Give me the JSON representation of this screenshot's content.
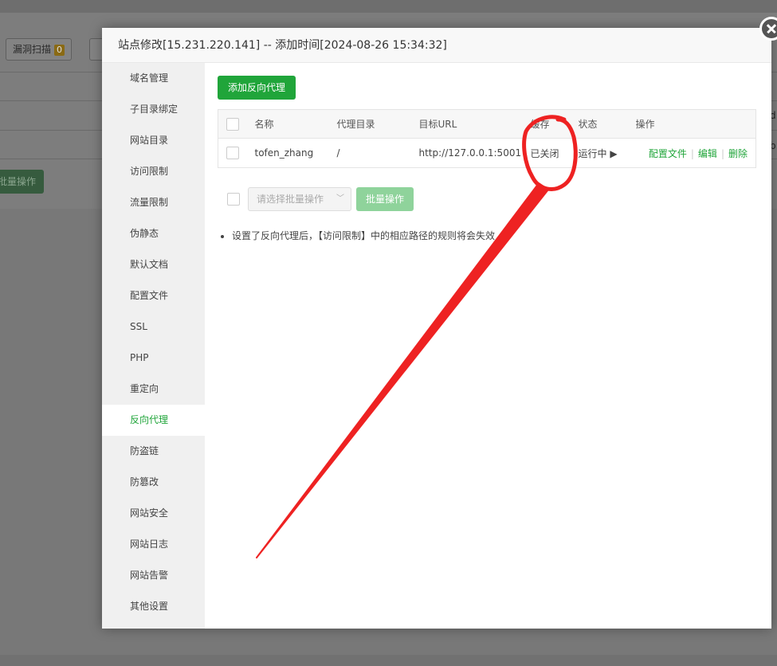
{
  "background": {
    "scan_button_label": "漏洞扫描",
    "scan_badge": "0",
    "batch_label": "批量操作",
    "right_char_1": "d",
    "right_char_2": "b"
  },
  "modal": {
    "title": "站点修改[15.231.220.141] -- 添加时间[2024-08-26 15:34:32]"
  },
  "sidebar": {
    "items": [
      {
        "label": "域名管理"
      },
      {
        "label": "子目录绑定"
      },
      {
        "label": "网站目录"
      },
      {
        "label": "访问限制"
      },
      {
        "label": "流量限制"
      },
      {
        "label": "伪静态"
      },
      {
        "label": "默认文档"
      },
      {
        "label": "配置文件"
      },
      {
        "label": "SSL"
      },
      {
        "label": "PHP"
      },
      {
        "label": "重定向"
      },
      {
        "label": "反向代理",
        "active": true
      },
      {
        "label": "防盗链"
      },
      {
        "label": "防篡改"
      },
      {
        "label": "网站安全"
      },
      {
        "label": "网站日志"
      },
      {
        "label": "网站告警"
      },
      {
        "label": "其他设置"
      }
    ]
  },
  "proxy": {
    "add_button": "添加反向代理",
    "columns": {
      "name": "名称",
      "dir": "代理目录",
      "url": "目标URL",
      "cache": "缓存",
      "status": "状态",
      "actions": "操作"
    },
    "rows": [
      {
        "name": "tofen_zhang",
        "dir": "/",
        "url": "http://127.0.0.1:5001",
        "cache": "已关闭",
        "status": "运行中",
        "status_icon": "▶",
        "action_config": "配置文件",
        "action_edit": "编辑",
        "action_delete": "删除"
      }
    ],
    "batch_placeholder": "请选择批量操作",
    "batch_button": "批量操作",
    "note": "设置了反向代理后，【访问限制】中的相应路径的规则将会失效"
  },
  "colors": {
    "accent": "#20a53a",
    "danger": "#ee1111",
    "annotation": "#ee2222"
  }
}
